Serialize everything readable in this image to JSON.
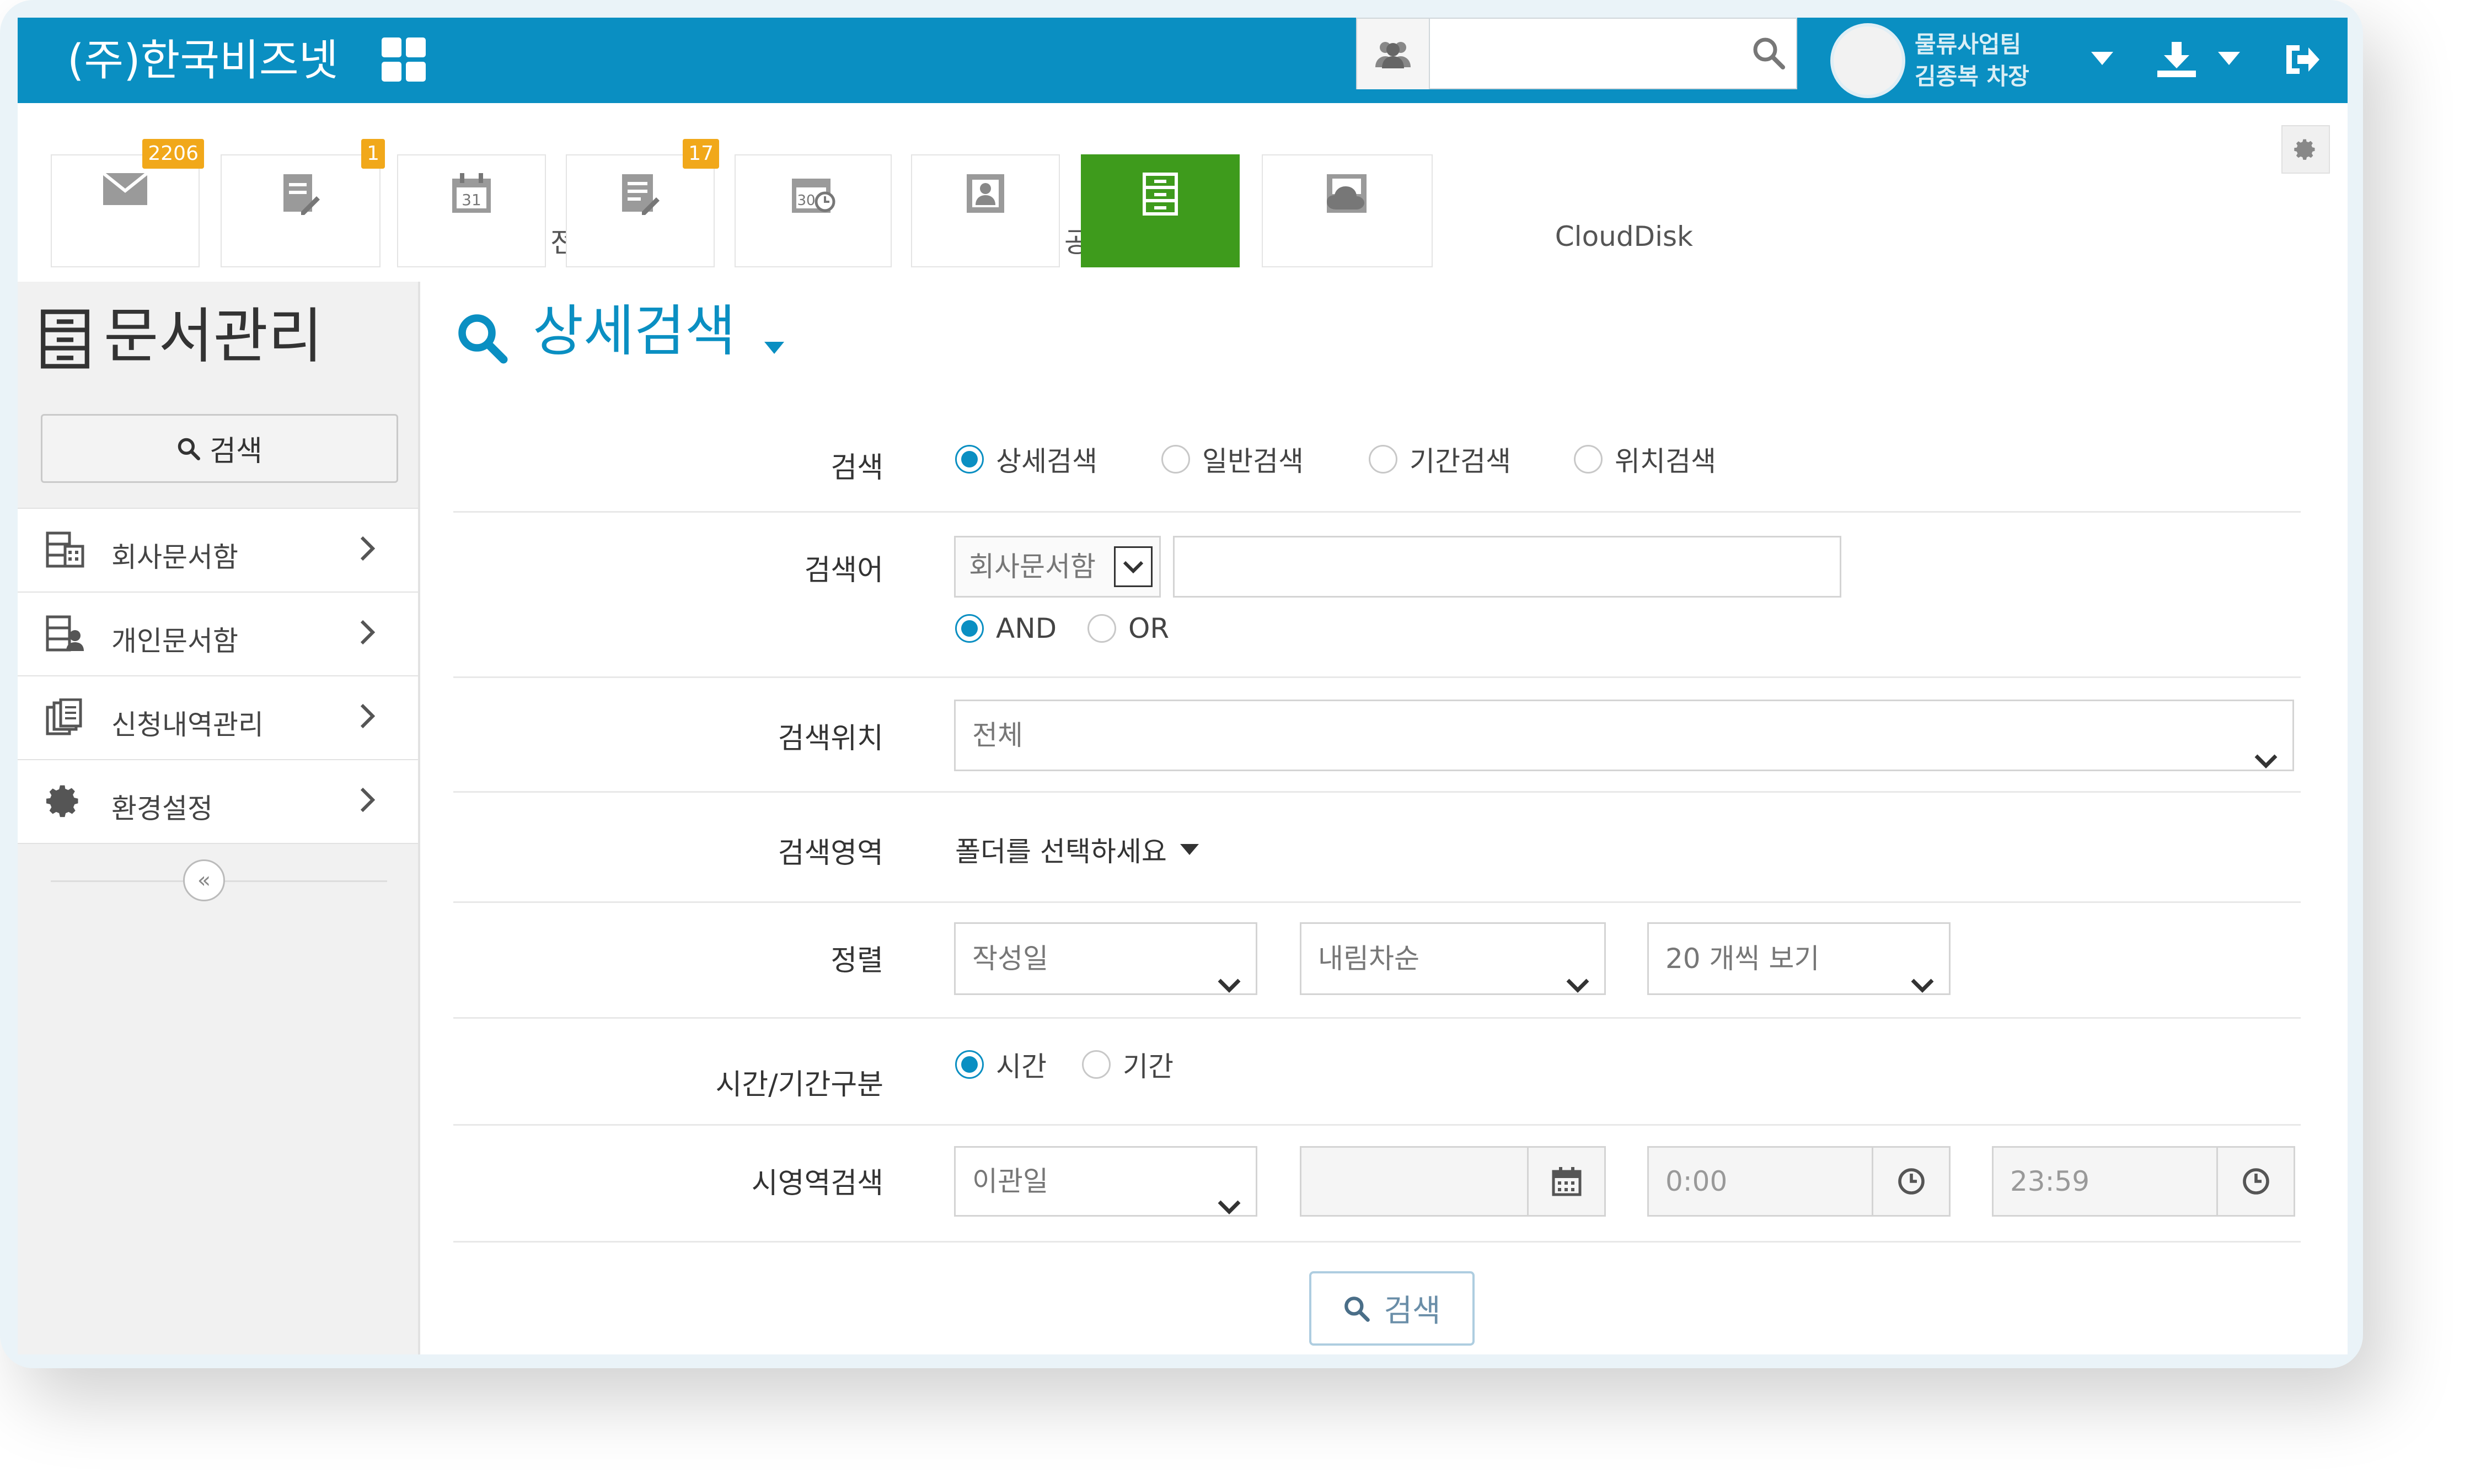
{
  "header": {
    "brand": "(주)한국비즈넷",
    "search_placeholder": "",
    "user_dept": "물류사업팀",
    "user_name": "김종복 차장"
  },
  "tiles": [
    {
      "label": "메일",
      "badge": "2206"
    },
    {
      "label": "전자결재",
      "badge": "1"
    },
    {
      "label": "일정",
      "badge": ""
    },
    {
      "label": "게시판",
      "badge": "17"
    },
    {
      "label": "공용설비",
      "badge": ""
    },
    {
      "label": "주소록",
      "badge": ""
    },
    {
      "label": "문서관리",
      "badge": "",
      "active": true
    },
    {
      "label": "CloudDisk",
      "badge": ""
    }
  ],
  "sidebar": {
    "title": "문서관리",
    "search_label": "검색",
    "items": [
      {
        "label": "회사문서함"
      },
      {
        "label": "개인문서함"
      },
      {
        "label": "신청내역관리"
      },
      {
        "label": "환경설정"
      }
    ]
  },
  "main": {
    "title": "상세검색",
    "search_type": {
      "label": "검색",
      "options": [
        "상세검색",
        "일반검색",
        "기간검색",
        "위치검색"
      ],
      "selected": "상세검색"
    },
    "keyword": {
      "label": "검색어",
      "scope_value": "회사문서함",
      "input_value": "",
      "operators": [
        "AND",
        "OR"
      ],
      "selected_operator": "AND"
    },
    "location": {
      "label": "검색위치",
      "value": "전체"
    },
    "area": {
      "label": "검색영역",
      "value": "폴더를 선택하세요"
    },
    "sort": {
      "label": "정렬",
      "field": "작성일",
      "order": "내림차순",
      "page_size": "20 개씩 보기"
    },
    "time_type": {
      "label": "시간/기간구분",
      "options": [
        "시간",
        "기간"
      ],
      "selected": "시간"
    },
    "time_search": {
      "label": "시영역검색",
      "field": "이관일",
      "date": "",
      "start_time": "0:00",
      "end_time": "23:59"
    },
    "search_button": "검색"
  },
  "colors": {
    "brand_blue": "#0a8fc2",
    "active_green": "#3e9b1c",
    "badge_orange": "#f1a81a"
  }
}
